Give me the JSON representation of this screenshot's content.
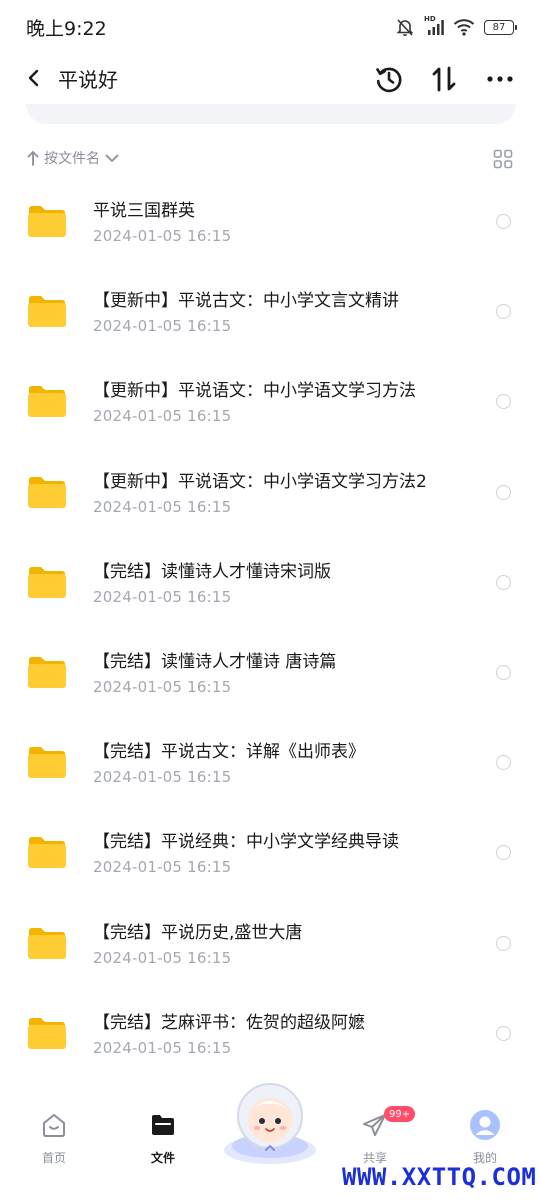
{
  "status_bar": {
    "time": "晚上9:22",
    "network_label": "HD",
    "battery_level": "87"
  },
  "header": {
    "title": "平说好",
    "back_icon": "chevron-left-icon",
    "actions": [
      "history-icon",
      "sort-arrows-icon",
      "more-icon"
    ]
  },
  "sort": {
    "label": "按文件名",
    "direction_icon": "arrow-up-icon",
    "view_icon": "grid-view-icon"
  },
  "files": [
    {
      "name": "平说三国群英",
      "date": "2024-01-05  16:15"
    },
    {
      "name": "【更新中】平说古文：中小学文言文精讲",
      "date": "2024-01-05  16:15"
    },
    {
      "name": "【更新中】平说语文：中小学语文学习方法",
      "date": "2024-01-05  16:15"
    },
    {
      "name": "【更新中】平说语文：中小学语文学习方法2",
      "date": "2024-01-05  16:15"
    },
    {
      "name": "【完结】读懂诗人才懂诗宋词版",
      "date": "2024-01-05  16:15"
    },
    {
      "name": "【完结】读懂诗人才懂诗 唐诗篇",
      "date": "2024-01-05  16:15"
    },
    {
      "name": "【完结】平说古文：详解《出师表》",
      "date": "2024-01-05  16:15"
    },
    {
      "name": "【完结】平说经典：中小学文学经典导读",
      "date": "2024-01-05  16:15"
    },
    {
      "name": "【完结】平说历史,盛世大唐",
      "date": "2024-01-05  16:15"
    },
    {
      "name": "【完结】芝麻评书：佐贺的超级阿嬷",
      "date": "2024-01-05  16:15"
    }
  ],
  "bottom_nav": {
    "home": "首页",
    "files": "文件",
    "share": "共享",
    "share_badge": "99+",
    "mine": "我的"
  },
  "watermark": "WWW.XXTTQ.COM",
  "colors": {
    "folder": "#ffcc33",
    "badge": "#ff4d6a",
    "watermark": "#1d2fd6",
    "secondary_text": "#a3a8b2"
  }
}
